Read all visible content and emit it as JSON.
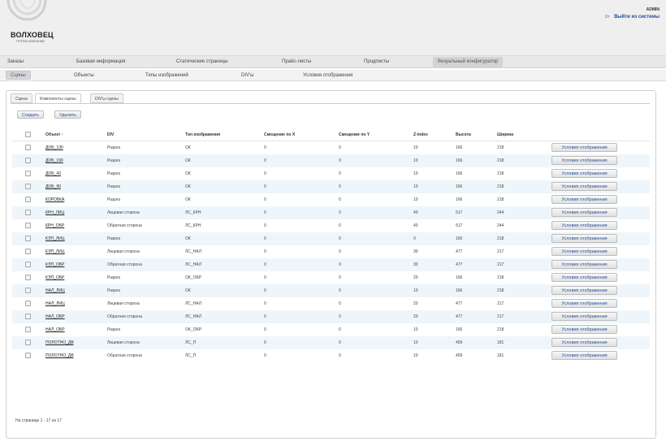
{
  "header": {
    "brand": "ВОЛХОВЕЦ",
    "brand_sub": "ГРУППА КОМПАНИЙ",
    "user": "ADMIN",
    "lock_label": "Ог",
    "logout": "Выйти из системы"
  },
  "nav_main": [
    "Заказы",
    "Базовая информация",
    "Статические страницы",
    "Прайс-листы",
    "Продписты",
    "Визуальный конфигуратор"
  ],
  "nav_sub": [
    "Сцены",
    "Объекты",
    "Типы изображений",
    "DIV'ы",
    "Условия отображения"
  ],
  "tabs": [
    "Сцена",
    "Компоненты сцены",
    "DIV'ы сцены"
  ],
  "actions": {
    "create": "Создать",
    "delete": "Удалить"
  },
  "columns": [
    "Объект ↑",
    "DIV",
    "Тип изображения",
    "Смещение по X",
    "Смещение по Y",
    "Z-index",
    "Высота",
    "Ширина"
  ],
  "row_button": "Условия отображения",
  "rows": [
    [
      "ДОБ_130",
      "Разрез",
      "ОК",
      "0",
      "0",
      "10",
      "166",
      "218"
    ],
    [
      "ДОБ_190",
      "Разрез",
      "ОК",
      "0",
      "0",
      "10",
      "166",
      "218"
    ],
    [
      "ДОБ_43",
      "Разрез",
      "ОК",
      "0",
      "0",
      "10",
      "166",
      "218"
    ],
    [
      "ДОБ_90",
      "Разрез",
      "ОК",
      "0",
      "0",
      "10",
      "166",
      "218"
    ],
    [
      "КОРОБКА",
      "Разрез",
      "ОК",
      "0",
      "0",
      "10",
      "166",
      "218"
    ],
    [
      "КРН_ЛИЦ",
      "Лицевая сторона",
      "ЛС_КРН",
      "0",
      "0",
      "40",
      "517",
      "244"
    ],
    [
      "КРН_ОБР",
      "Обратная сторона",
      "ЛС_КРН",
      "0",
      "0",
      "40",
      "517",
      "244"
    ],
    [
      "КЭП_ЛИЦ",
      "Разрез",
      "ОК",
      "0",
      "0",
      "0",
      "166",
      "218"
    ],
    [
      "КЭП_ЛИЦ",
      "Лицевая сторона",
      "ЛС_НАЛ",
      "0",
      "0",
      "30",
      "477",
      "217"
    ],
    [
      "КЭП_ОБР",
      "Обратная сторона",
      "ЛС_НАЛ",
      "0",
      "0",
      "30",
      "477",
      "217"
    ],
    [
      "КЭП_ОБР",
      "Разрез",
      "ОК_ОБР",
      "0",
      "0",
      "20",
      "166",
      "218"
    ],
    [
      "НАЛ_ЛИЦ",
      "Разрез",
      "ОК",
      "0",
      "0",
      "10",
      "166",
      "218"
    ],
    [
      "НАЛ_ЛИЦ",
      "Лицевая сторона",
      "ЛС_НАЛ",
      "0",
      "0",
      "20",
      "477",
      "217"
    ],
    [
      "НАЛ_ОБР",
      "Обратная сторона",
      "ЛС_НАЛ",
      "0",
      "0",
      "20",
      "477",
      "217"
    ],
    [
      "НАЛ_ОБР",
      "Разрез",
      "ОК_ОБР",
      "0",
      "0",
      "10",
      "166",
      "218"
    ],
    [
      "ПОЛОТНО_ДВ",
      "Лицевая сторона",
      "ЛС_П",
      "0",
      "0",
      "10",
      "459",
      "181"
    ],
    [
      "ПОЛОТНО_ДВ",
      "Обратная сторона",
      "ЛС_П",
      "0",
      "0",
      "10",
      "459",
      "181"
    ]
  ],
  "pager": "На странице 1 - 17 из 17"
}
